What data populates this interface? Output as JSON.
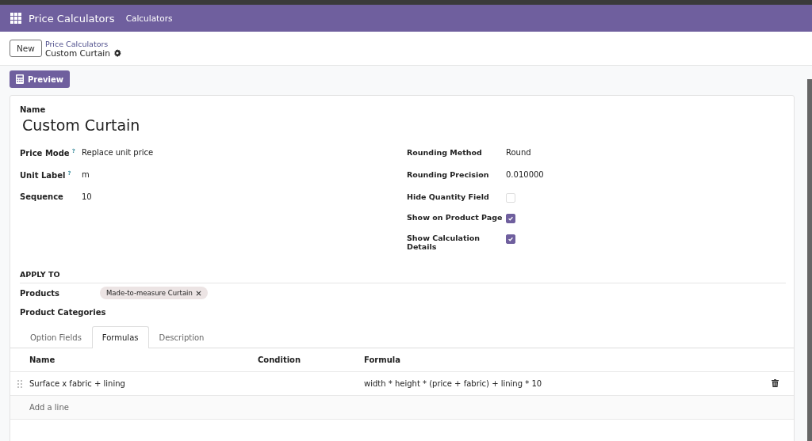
{
  "navbar": {
    "app_name": "Price Calculators",
    "menu": [
      "Calculators"
    ]
  },
  "control_panel": {
    "new_button": "New",
    "breadcrumb": "Price Calculators",
    "record": "Custom Curtain"
  },
  "actions": {
    "preview_button": "Preview"
  },
  "form": {
    "name_label": "Name",
    "name": "Custom Curtain",
    "left_fields": [
      {
        "label": "Price Mode",
        "help": "?",
        "value": "Replace unit price"
      },
      {
        "label": "Unit Label",
        "help": "?",
        "value": "m"
      },
      {
        "label": "Sequence",
        "value": "10"
      }
    ],
    "right_fields": [
      {
        "kind": "text",
        "label": "Rounding Method",
        "value": "Round"
      },
      {
        "kind": "text",
        "label": "Rounding Precision",
        "value": "0.010000"
      },
      {
        "kind": "checkbox",
        "label": "Hide Quantity Field",
        "checked": false
      },
      {
        "kind": "checkbox",
        "label": "Show on Product Page",
        "checked": true
      },
      {
        "kind": "checkbox",
        "label": "Show Calculation Details",
        "checked": true
      }
    ],
    "apply_to": {
      "title": "APPLY TO",
      "products_label": "Products",
      "products": [
        "Made-to-measure Curtain"
      ],
      "categories_label": "Product Categories"
    },
    "tabs": [
      {
        "label": "Option Fields",
        "selected": false
      },
      {
        "label": "Formulas",
        "selected": true
      },
      {
        "label": "Description",
        "selected": false
      }
    ],
    "table": {
      "columns": [
        "Name",
        "Condition",
        "Formula"
      ],
      "rows": [
        {
          "name": "Surface x fabric + lining",
          "formula": "width * height * (price + fabric) + lining * 10"
        }
      ],
      "add_line": "Add a line"
    }
  }
}
